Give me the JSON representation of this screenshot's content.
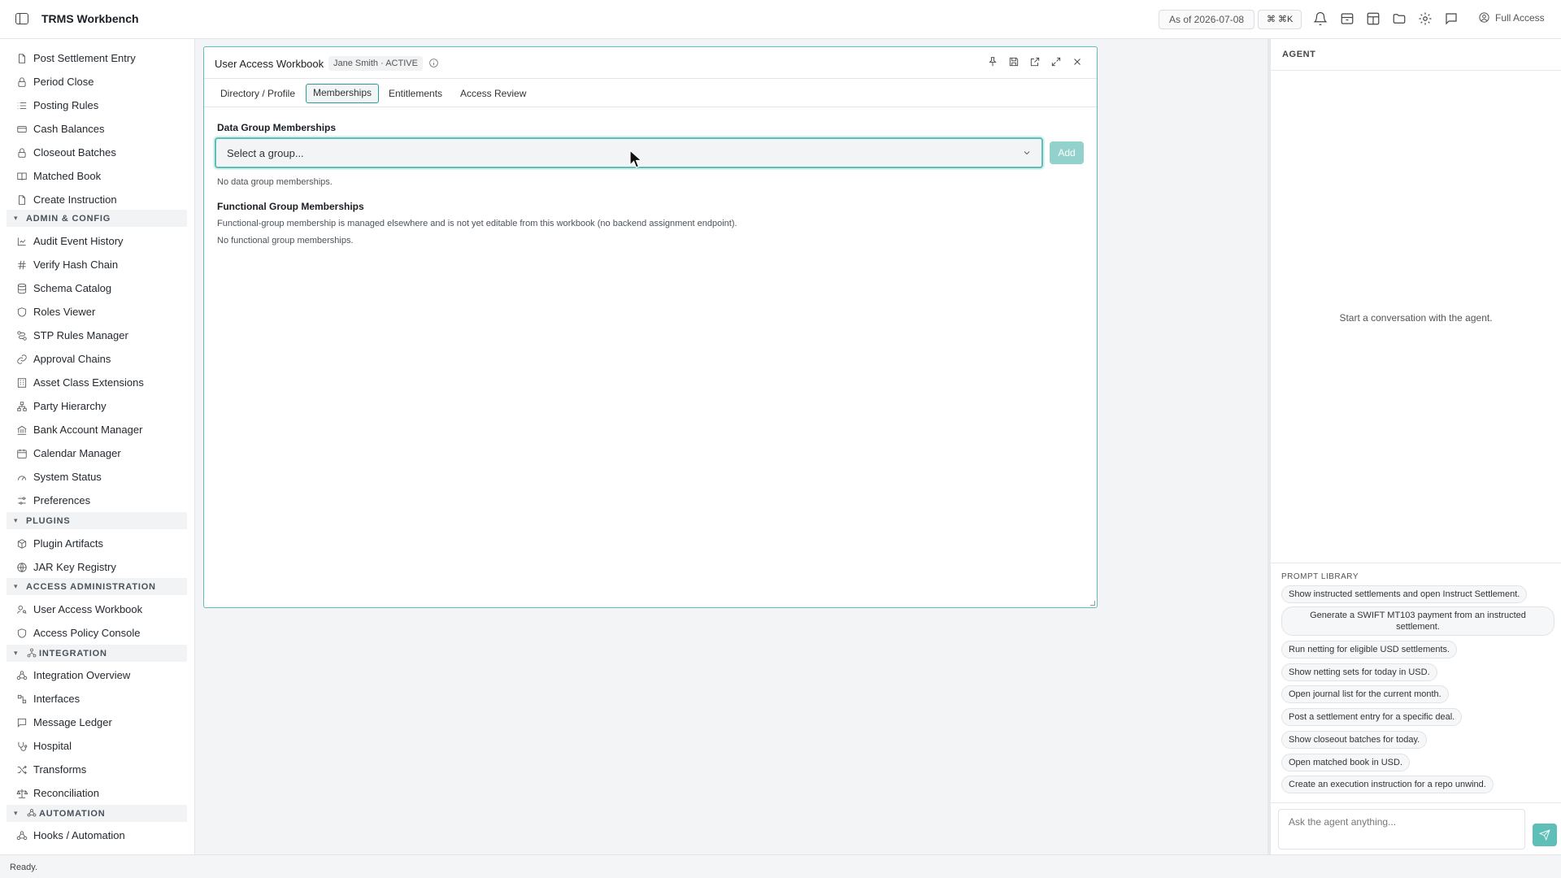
{
  "app": {
    "title": "TRMS Workbench"
  },
  "topbar": {
    "as_of": "As of 2026-07-08",
    "shortcut": "⌘ ⌘K",
    "access_label": "Full Access",
    "icons": [
      "bell-icon",
      "archive-icon",
      "layout-icon",
      "folder-icon",
      "gear-icon",
      "message-icon"
    ]
  },
  "sidebar": {
    "items_top": [
      {
        "label": "Post Settlement Entry",
        "icon": "file-icon"
      },
      {
        "label": "Period Close",
        "icon": "lock-icon"
      },
      {
        "label": "Posting Rules",
        "icon": "list-icon"
      },
      {
        "label": "Cash Balances",
        "icon": "cash-icon"
      },
      {
        "label": "Closeout Batches",
        "icon": "lock-icon"
      },
      {
        "label": "Matched Book",
        "icon": "book-icon"
      },
      {
        "label": "Create Instruction",
        "icon": "file-icon"
      }
    ],
    "sections": {
      "admin": "ADMIN & CONFIG",
      "plugins": "PLUGINS",
      "access": "ACCESS ADMINISTRATION",
      "integration": "INTEGRATION",
      "automation": "AUTOMATION"
    },
    "admin_items": [
      {
        "label": "Audit Event History",
        "icon": "history-icon"
      },
      {
        "label": "Verify Hash Chain",
        "icon": "hash-icon"
      },
      {
        "label": "Schema Catalog",
        "icon": "database-icon"
      },
      {
        "label": "Roles Viewer",
        "icon": "shield-icon"
      },
      {
        "label": "STP Rules Manager",
        "icon": "route-icon"
      },
      {
        "label": "Approval Chains",
        "icon": "link-icon"
      },
      {
        "label": "Asset Class Extensions",
        "icon": "building-icon"
      },
      {
        "label": "Party Hierarchy",
        "icon": "hierarchy-icon"
      },
      {
        "label": "Bank Account Manager",
        "icon": "bank-icon"
      },
      {
        "label": "Calendar Manager",
        "icon": "calendar-icon"
      },
      {
        "label": "System Status",
        "icon": "gauge-icon"
      },
      {
        "label": "Preferences",
        "icon": "sliders-icon"
      }
    ],
    "plugin_items": [
      {
        "label": "Plugin Artifacts",
        "icon": "package-icon"
      },
      {
        "label": "JAR Key Registry",
        "icon": "globe-icon"
      }
    ],
    "access_items": [
      {
        "label": "User Access Workbook",
        "icon": "user-key-icon"
      },
      {
        "label": "Access Policy Console",
        "icon": "shield-icon"
      }
    ],
    "integration_items": [
      {
        "label": "Integration Overview",
        "icon": "webhook-icon"
      },
      {
        "label": "Interfaces",
        "icon": "interface-icon"
      },
      {
        "label": "Message Ledger",
        "icon": "message-icon"
      },
      {
        "label": "Hospital",
        "icon": "stethoscope-icon"
      },
      {
        "label": "Transforms",
        "icon": "shuffle-icon"
      },
      {
        "label": "Reconciliation",
        "icon": "scale-icon"
      }
    ],
    "automation_items": [
      {
        "label": "Hooks / Automation",
        "icon": "webhook-icon"
      }
    ]
  },
  "panel": {
    "title": "User Access Workbook",
    "badge": "Jane Smith · ACTIVE",
    "tabs": [
      "Directory / Profile",
      "Memberships",
      "Entitlements",
      "Access Review"
    ],
    "active_tab": "Memberships",
    "data_groups": {
      "title": "Data Group Memberships",
      "select_placeholder": "Select a group...",
      "add_label": "Add",
      "empty": "No data group memberships."
    },
    "functional_groups": {
      "title": "Functional Group Memberships",
      "note": "Functional-group membership is managed elsewhere and is not yet editable from this workbook (no backend assignment endpoint).",
      "empty": "No functional group memberships."
    }
  },
  "agent": {
    "title": "AGENT",
    "empty": "Start a conversation with the agent.",
    "prompt_library_title": "PROMPT LIBRARY",
    "prompts": [
      "Show instructed settlements and open Instruct Settlement.",
      "Generate a SWIFT MT103 payment from an instructed settlement.",
      "Run netting for eligible USD settlements.",
      "Show netting sets for today in USD.",
      "Open journal list for the current month.",
      "Post a settlement entry for a specific deal.",
      "Show closeout batches for today.",
      "Open matched book in USD.",
      "Create an execution instruction for a repo unwind."
    ],
    "input_placeholder": "Ask the agent anything..."
  },
  "status": {
    "text": "Ready."
  },
  "colors": {
    "accent": "#5dbfb8",
    "accent_dark": "#2a9d94",
    "add_button": "#93d2cc"
  }
}
